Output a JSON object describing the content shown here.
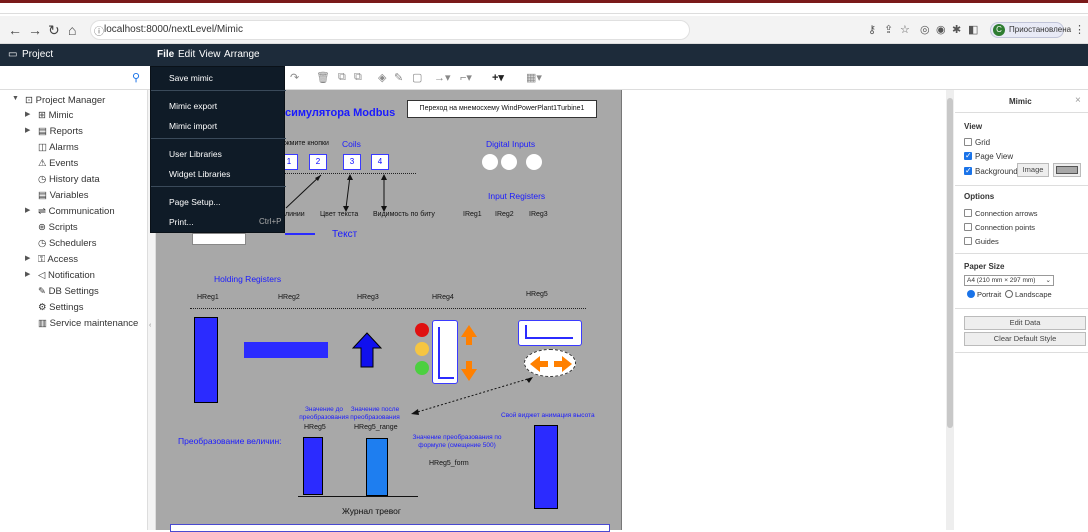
{
  "browser": {
    "url": "localhost:8000/nextLevel/Mimic",
    "profile_label": "Приостановлена",
    "profile_initial": "C"
  },
  "appbar": {
    "project_label": "Project",
    "menus": [
      "File",
      "Edit",
      "View",
      "Arrange"
    ]
  },
  "file_menu": {
    "items": [
      "Save mimic",
      "Mimic export",
      "Mimic import",
      "User Libraries",
      "Widget Libraries",
      "Page Setup...",
      "Print..."
    ],
    "print_shortcut": "Ctrl+P"
  },
  "sidebar": {
    "root": "Project Manager",
    "items": [
      "Mimic",
      "Reports",
      "Alarms",
      "Events",
      "History data",
      "Variables",
      "Communication",
      "Scripts",
      "Schedulers",
      "Access",
      "Notification",
      "DB Settings",
      "Settings",
      "Service maintenance"
    ]
  },
  "mimic": {
    "title_fragment": "симулятора Modbus",
    "nav_button": "Переход на мнемосхему WindPowerPlant1Turbine1",
    "press_buttons": "жмите кнопки",
    "coils": "Coils",
    "coil_values": [
      "2",
      "3",
      "4"
    ],
    "digital_inputs": "Digital Inputs",
    "input_registers": "Input Registers",
    "ireg_labels": [
      "IReg1",
      "IReg2",
      "IReg3"
    ],
    "label_fragment": "линии",
    "text_color": "Цвет текста",
    "bit_visibility": "Видимость по биту",
    "text_label": "Текст",
    "holding_registers": "Holding Registers",
    "hreg_labels": [
      "HReg1",
      "HReg2",
      "HReg3",
      "HReg4",
      "HReg5"
    ],
    "before_conv": "Значение до преобразования",
    "before_reg": "HReg5",
    "after_conv": "Значение после преобразования",
    "after_reg": "HReg5_range",
    "own_widget": "Свой виджет анимация высота",
    "conversion_label": "Преобразование величин:",
    "formula_label": "Значение преобразования по формуле (смещение 500)",
    "formula_reg": "HReg5_form",
    "alarm_journal": "Журнал тревог"
  },
  "right_panel": {
    "title": "Mimic",
    "view_header": "View",
    "grid": "Grid",
    "page_view": "Page View",
    "background": "Background",
    "image_button": "Image",
    "options_header": "Options",
    "connection_arrows": "Connection arrows",
    "connection_points": "Connection points",
    "guides": "Guides",
    "paper_size_header": "Paper Size",
    "paper_size_value": "A4 (210 mm × 297 mm)",
    "portrait": "Portrait",
    "landscape": "Landscape",
    "edit_data": "Edit Data",
    "clear_style": "Clear Default Style"
  },
  "colors": {
    "app_bar": "#1d2b3a",
    "menu_bg": "#0f1b27",
    "canvas_bg": "#a8a8a8",
    "widget_blue": "#2b2bff",
    "accent": "#1a73e8"
  }
}
